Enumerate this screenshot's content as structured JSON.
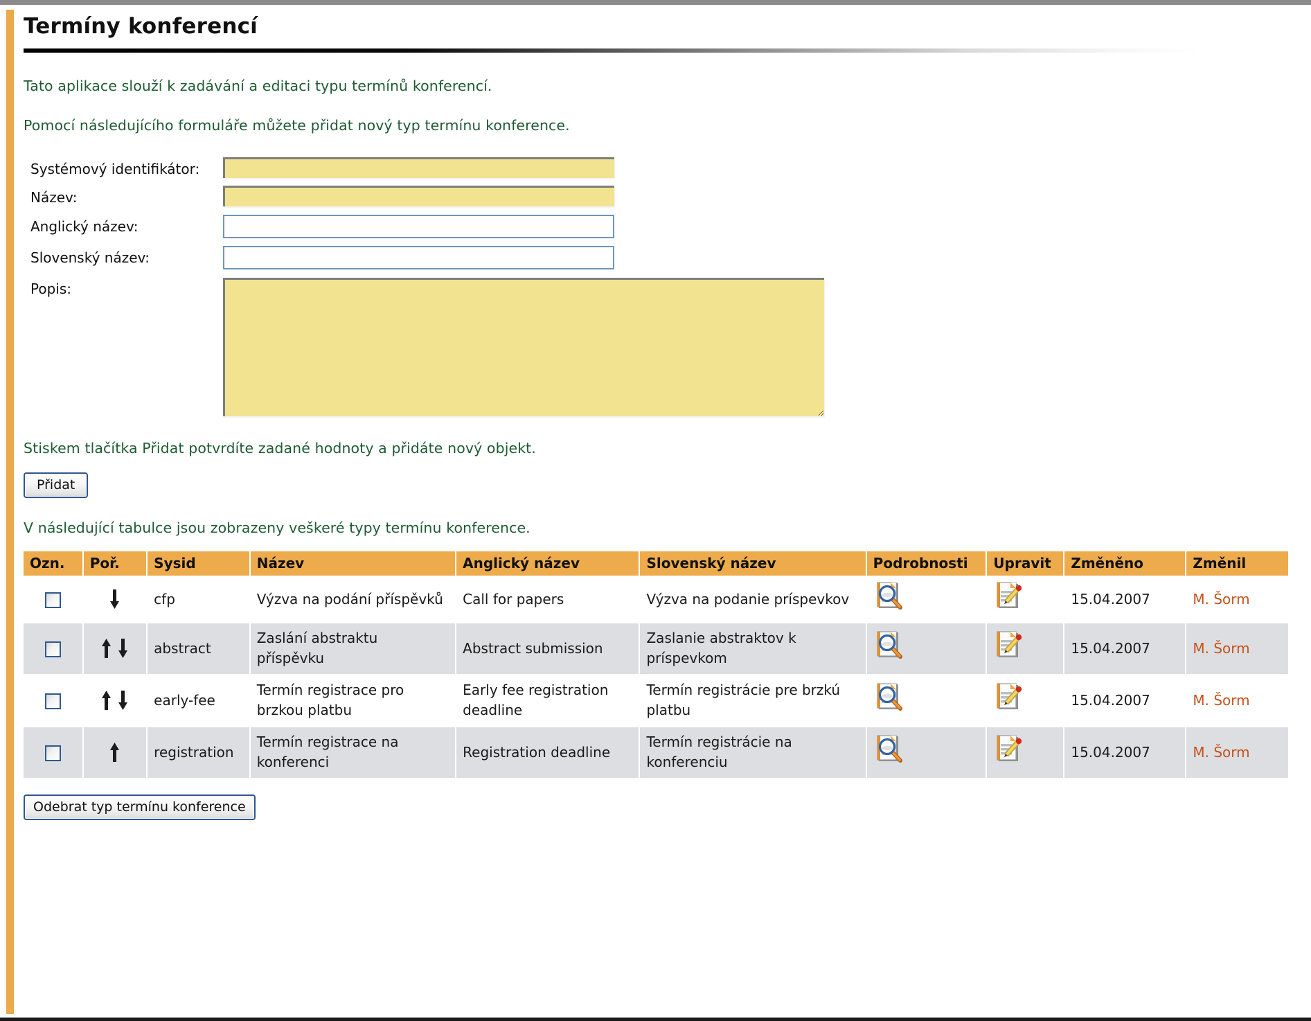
{
  "page": {
    "title": "Termíny konferencí",
    "intro_line1": "Tato aplikace slouží k zadávání a editaci typu termínů konferencí.",
    "intro_line2": "Pomocí následujícího formuláře můžete přidat nový typ termínu konference.",
    "hint": "Stiskem tlačítka Přidat potvrdíte zadané hodnoty a přidáte nový objekt.",
    "table_intro": "V následující tabulce jsou zobrazeny veškeré typy termínu konference."
  },
  "form": {
    "fields": [
      {
        "label": "Systémový identifikátor:",
        "value": "",
        "required": true
      },
      {
        "label": "Název:",
        "value": "",
        "required": true
      },
      {
        "label": "Anglický název:",
        "value": "",
        "required": false
      },
      {
        "label": "Slovenský název:",
        "value": "",
        "required": false
      }
    ],
    "description": {
      "label": "Popis:",
      "value": ""
    },
    "add_button": "Přidat"
  },
  "actions": {
    "remove_button": "Odebrat typ termínu konference"
  },
  "table": {
    "headers": [
      "Ozn.",
      "Poř.",
      "Sysid",
      "Název",
      "Anglický název",
      "Slovenský název",
      "Podrobnosti",
      "Upravit",
      "Změněno",
      "Změnil"
    ],
    "rows": [
      {
        "checked": false,
        "order_up": false,
        "order_down": true,
        "sysid": "cfp",
        "nazev": "Výzva na podání příspěvků",
        "anglicky": "Call for papers",
        "slovensky": "Výzva na podanie príspevkov",
        "detail_icon": "document-magnifier-icon",
        "edit_icon": "document-pencil-icon",
        "zmeneno": "15.04.2007",
        "zmenil": "M. Šorm"
      },
      {
        "checked": false,
        "order_up": true,
        "order_down": true,
        "sysid": "abstract",
        "nazev": "Zaslání abstraktu příspěvku",
        "anglicky": "Abstract submission",
        "slovensky": "Zaslanie abstraktov k príspevkom",
        "detail_icon": "document-magnifier-icon",
        "edit_icon": "document-pencil-icon",
        "zmeneno": "15.04.2007",
        "zmenil": "M. Šorm"
      },
      {
        "checked": false,
        "order_up": true,
        "order_down": true,
        "sysid": "early-fee",
        "nazev": "Termín registrace pro brzkou platbu",
        "anglicky": "Early fee registration deadline",
        "slovensky": "Termín registrácie pre brzkú platbu",
        "detail_icon": "document-magnifier-icon",
        "edit_icon": "document-pencil-icon",
        "zmeneno": "15.04.2007",
        "zmenil": "M. Šorm"
      },
      {
        "checked": false,
        "order_up": true,
        "order_down": false,
        "sysid": "registration",
        "nazev": "Termín registrace na konferenci",
        "anglicky": "Registration deadline",
        "slovensky": "Termín registrácie na konferenciu",
        "detail_icon": "document-magnifier-icon",
        "edit_icon": "document-pencil-icon",
        "zmeneno": "15.04.2007",
        "zmenil": "M. Šorm"
      }
    ]
  },
  "colors": {
    "accent_orange": "#eeab4c",
    "left_bar_orange": "#eaa94a",
    "intro_green": "#1f5b33",
    "link_rust": "#c4521b",
    "required_field_yellow": "#f2e391",
    "row_alt_gray": "#dcdee1",
    "optional_field_border_blue": "#6e94bc"
  }
}
